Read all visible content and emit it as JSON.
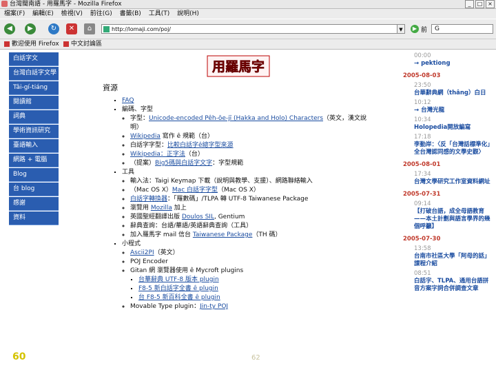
{
  "window": {
    "title": "台灣閩南語 - 用羅馬字 - Mozilla Firefox",
    "controls": [
      "_",
      "□",
      "×"
    ]
  },
  "menu": [
    "檔案(F)",
    "編輯(E)",
    "檢視(V)",
    "前往(G)",
    "書籤(B)",
    "工具(T)",
    "說明(H)"
  ],
  "toolbar": {
    "url": "http://lomaji.com/poj/",
    "go_label": "前",
    "search_placeholder": "G"
  },
  "bookmarks": [
    "歡迎使用 Firefox",
    "中文討論區"
  ],
  "sidebar": {
    "items": [
      "白話字文",
      "台灣白話字文學",
      "Tâi-gí-tiáng",
      "閱讀館",
      "詞典",
      "學術資訊研究",
      "臺語輸入",
      "網路 + 電腦",
      "Blog",
      "台 blog",
      "感謝",
      "資料"
    ]
  },
  "logo": {
    "text": "用羅馬字",
    "color": "#e11a1a"
  },
  "main": {
    "section_title": "資源",
    "faq": "FAQ",
    "cat_encoding": "編碼、字型",
    "enc_items": [
      {
        "pre": "字型：",
        "link": "Unicode-encoded Pêh-ōe-jī (Hakka and Holo) Characters",
        "post": "（英文，漢文說明）"
      },
      {
        "pre": "",
        "link": "Wikipedia",
        "post": " 寫作 ê 規範（台）"
      },
      {
        "pre": "白話字字型：",
        "link": "比較白話字ê總字型來源",
        "post": ""
      },
      {
        "pre": "",
        "link": "Wikipedia：正字法",
        "post": "（台）"
      },
      {
        "pre": "（提案）",
        "link": "Big5碼與白話字文字",
        "post": "：字型規範"
      }
    ],
    "cat_tools": "工具",
    "tool_items": [
      {
        "pre": "輸入法：Taigi Keymap 下載（說明與教學、支援）、",
        "link": "",
        "post": "網路聯絡輸入"
      },
      {
        "pre": "（Mac OS X）",
        "link": "Mac 白話字字型",
        "post": "（Mac OS X）"
      },
      {
        "pre": "",
        "link": "白話字轉換器",
        "post": "：「羅數碼」/TLPA 轉 UTF-8 Taiwanese Package"
      },
      {
        "pre": "瀏覽用 ",
        "link": "Mozilla",
        "post": " 加上"
      },
      {
        "pre": "英國聖經翻譯出版 ",
        "link": "Doulos SIL",
        "post": ", Gentium"
      },
      {
        "pre": "辭典查詢：台語/華語/英語",
        "link": "",
        "post": "辭典查詢（工具）"
      },
      {
        "pre": "加入羅馬字 mail 信台 ",
        "link": "Taiwanese Package",
        "post": "（TH 碼）"
      }
    ],
    "cat_programs": "小程式",
    "prog_items": [
      {
        "pre": "",
        "link": "Ascii2PI",
        "post": "（英文）"
      },
      {
        "pre": "POJ Encoder",
        "link": "",
        "post": ""
      },
      {
        "pre": "Gitan 網 瀏覽器使用 ê Mycroft plugins",
        "link": "",
        "post": ""
      },
      {
        "pre": "Movable Type plugin：",
        "link": "Jin-ty POJ",
        "post": ""
      }
    ],
    "plugin_items": [
      {
        "pre": "",
        "link": "台華辭典 UTF-8 版本 plugin",
        "post": ""
      },
      {
        "pre": "",
        "link": "F8-5 新白話字全書 ê plugin",
        "post": ""
      },
      {
        "pre": "",
        "link": "台 F8-5 新百科全書 ê plugin",
        "post": ""
      }
    ]
  },
  "blog": {
    "groups": [
      {
        "date": "",
        "entries": [
          {
            "time": "00:00",
            "title": "→ pektiong"
          }
        ]
      },
      {
        "date": "2005-08-03",
        "entries": [
          {
            "time": "23:50",
            "title": "台華辭典網（thâng）白日"
          },
          {
            "time": "10:12",
            "title": "→ 台灣光龍"
          },
          {
            "time": "10:34",
            "title": "Holopedia開放編寫"
          },
          {
            "time": "17:18",
            "title": "李勤岸：〈反「台灣話標準化」全台灣認同感的文學史觀〉"
          }
        ]
      },
      {
        "date": "2005-08-01",
        "entries": [
          {
            "time": "17:34",
            "title": "台灣文學研究工作室資料網址"
          }
        ]
      },
      {
        "date": "2005-07-31",
        "entries": [
          {
            "time": "09:14",
            "title": "【打破台語，成全母語教育——本土計劃與語言學界的幾個呼籲】"
          }
        ]
      },
      {
        "date": "2005-07-30",
        "entries": [
          {
            "time": "13:58",
            "title": "台南市社區大學「阿母的話」課程介紹"
          },
          {
            "time": "08:51",
            "title": "白話字、TLPA、通用台語拼音方案字詞合併調查文章"
          }
        ]
      }
    ]
  },
  "footer": {
    "slide_number": "60",
    "mark": "62"
  }
}
